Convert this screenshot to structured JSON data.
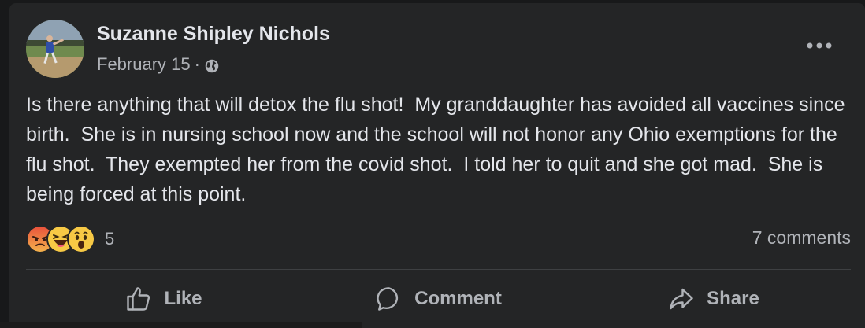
{
  "post": {
    "author": "Suzanne Shipley Nichols",
    "date": "February 15",
    "separator": "·",
    "privacy_icon": "globe-icon",
    "more_icon": "ellipsis-icon",
    "text": "Is there anything that will detox the flu shot!  My granddaughter has avoided all vaccines since birth.  She is in nursing school now and the school will not honor any Ohio exemptions for the flu shot.  They exempted her from the covid shot.  I told her to quit and she got mad.  She is being forced at this point."
  },
  "engagement": {
    "reaction_icons": [
      "angry-emoji-icon",
      "haha-emoji-icon",
      "wow-emoji-icon"
    ],
    "reaction_count": "5",
    "comments": "7 comments"
  },
  "actions": {
    "like": "Like",
    "comment": "Comment",
    "share": "Share"
  },
  "colors": {
    "card_background": "#242526",
    "page_background": "#18191a",
    "primary_text": "#e4e6eb",
    "secondary_text": "#b0b3b8"
  }
}
